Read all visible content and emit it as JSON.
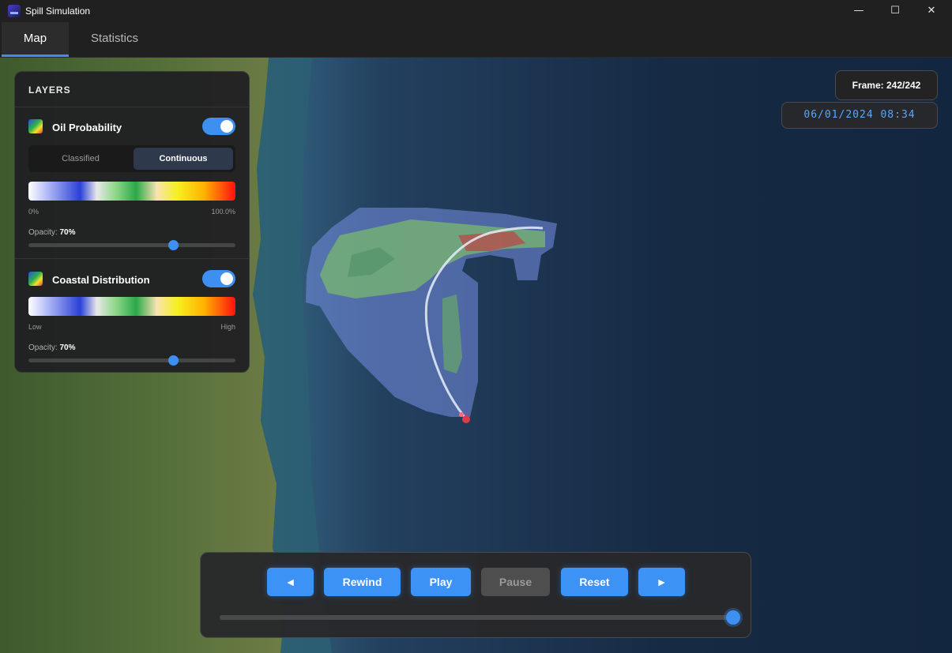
{
  "window": {
    "title": "Spill Simulation",
    "minimize": "—",
    "maximize": "☐",
    "close": "✕"
  },
  "tabs": [
    {
      "label": "Map",
      "active": true
    },
    {
      "label": "Statistics",
      "active": false
    }
  ],
  "layers": {
    "title": "LAYERS",
    "oil": {
      "name": "Oil Probability",
      "enabled": true,
      "modes": [
        "Classified",
        "Continuous"
      ],
      "selected_mode": "Continuous",
      "legend_min": "0%",
      "legend_max": "100.0%",
      "opacity_label": "Opacity:",
      "opacity_value": "70%",
      "opacity": 0.7
    },
    "coastal": {
      "name": "Coastal Distribution",
      "enabled": true,
      "legend_min": "Low",
      "legend_max": "High",
      "opacity_label": "Opacity:",
      "opacity_value": "70%",
      "opacity": 0.7
    }
  },
  "frame_label": "Frame: 242/242",
  "timestamp": "06/01/2024 08:34",
  "controls": {
    "prev": "◄",
    "rewind": "Rewind",
    "play": "Play",
    "pause": "Pause",
    "reset": "Reset",
    "next": "►",
    "pause_disabled": true,
    "progress": 1.0
  },
  "colors": {
    "accent": "#3d8ff2",
    "timestamp": "#5aa6ff",
    "spill_origin": "#e23a4a"
  }
}
